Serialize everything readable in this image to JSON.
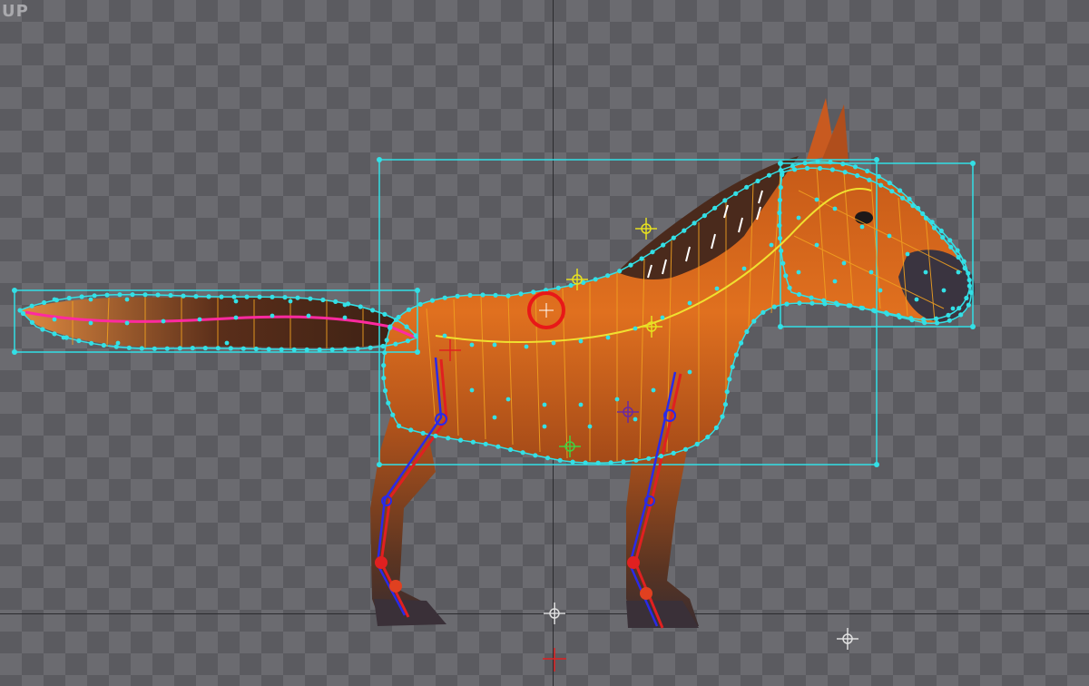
{
  "viewport": {
    "view_label": "UP",
    "background": "transparency-checkerboard"
  },
  "colors": {
    "mesh": "#33e0e6",
    "mesh_lines": "#f0a020",
    "bone_red": "#e02020",
    "bone_blue": "#2a2ae8",
    "spine": "#f0e030",
    "tail_bone": "#ff2aa0",
    "target": "#e81818",
    "horse_body": "#d9631c",
    "horse_dark": "#4a2a1c",
    "hoof": "#3a3038"
  },
  "objects": {
    "character": "horse-rig",
    "selection_handle": "root-target-icon"
  }
}
